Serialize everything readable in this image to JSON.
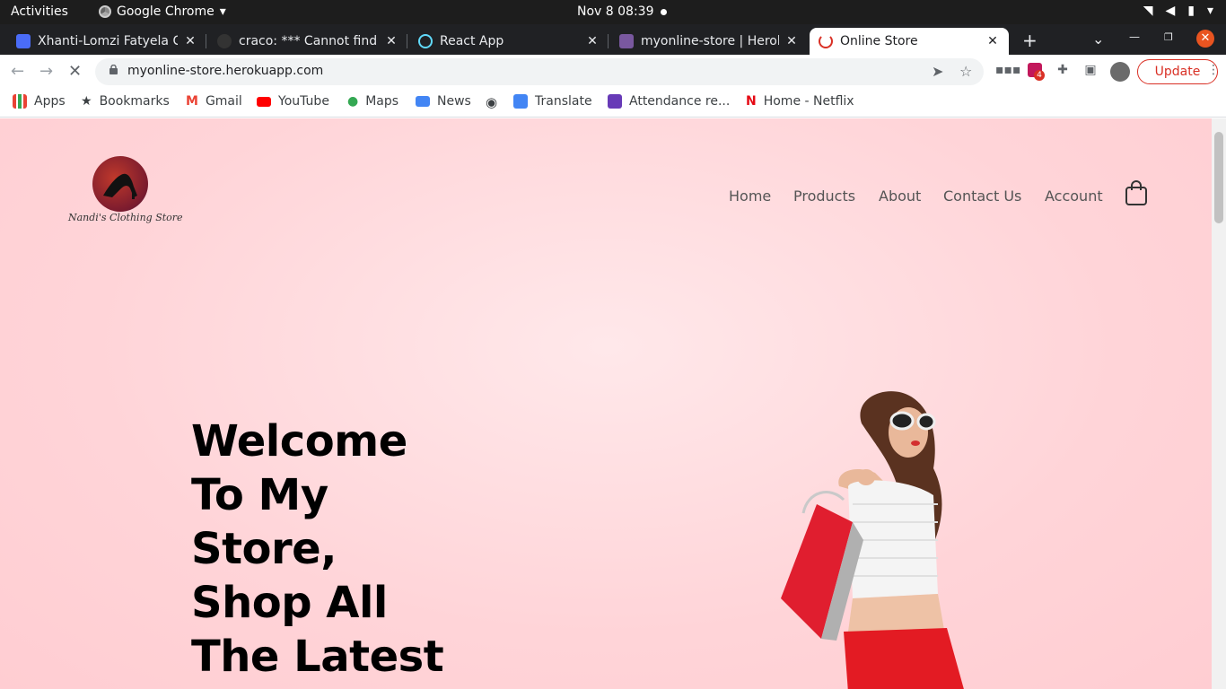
{
  "system": {
    "activities": "Activities",
    "app_name": "Google Chrome",
    "clock": "Nov 8  08:39"
  },
  "tabs": [
    {
      "label": "Xhanti-Lomzi Fatyela CV",
      "favicon_color": "#4a6cf7"
    },
    {
      "label": "craco: *** Cannot find E",
      "favicon_color": "#333333"
    },
    {
      "label": "React App",
      "favicon_color": "#61dafb"
    },
    {
      "label": "myonline-store | Heroku",
      "favicon_color": "#79589f"
    },
    {
      "label": "Online Store",
      "favicon_color": "#d93025"
    }
  ],
  "toolbar": {
    "url": "myonline-store.herokuapp.com",
    "update_label": "Update",
    "extension_badge": "4"
  },
  "bookmarks": [
    {
      "label": "Apps"
    },
    {
      "label": "Bookmarks"
    },
    {
      "label": "Gmail"
    },
    {
      "label": "YouTube"
    },
    {
      "label": "Maps"
    },
    {
      "label": "News"
    },
    {
      "label": ""
    },
    {
      "label": "Translate"
    },
    {
      "label": "Attendance re..."
    },
    {
      "label": "Home - Netflix"
    }
  ],
  "site": {
    "logo_text": "Nandi's Clothing Store",
    "nav": [
      "Home",
      "Products",
      "About",
      "Contact Us",
      "Account"
    ],
    "hero_lines": [
      "Welcome",
      "To My",
      "Store,",
      "Shop All",
      "The Latest"
    ]
  },
  "colors": {
    "page_bg": "#ffd4d8",
    "accent_red": "#d93025",
    "update_border": "#d93025"
  }
}
